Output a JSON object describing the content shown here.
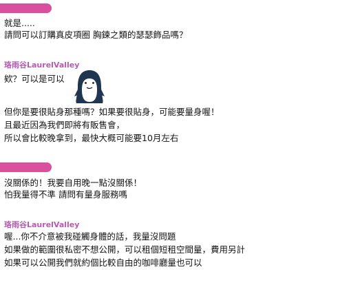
{
  "messages": [
    {
      "sender": "",
      "lines": [
        "就是.....",
        "請問可以訂購真皮項圈 胸鍊之類的瑟瑟飾品嗎？"
      ]
    },
    {
      "sender": "珞雨谷LaurelValley",
      "lines": [
        "欸？可以是可以"
      ]
    },
    {
      "sender": "",
      "lines": [
        "但你是要很貼身那種嗎？如果要很貼身，可能要量身喔！",
        "且最近因為我們即將有販售會，",
        "所以會比較晚拿到，最快大概可能要10月左右"
      ]
    },
    {
      "sender": "",
      "lines": [
        "沒關係的！我要自用晚一點沒關係！",
        "怕我量得不準 請問有量身服務嗎"
      ]
    },
    {
      "sender": "珞雨谷LaurelValley",
      "lines": [
        "喔...你不介意被我碰觸身體的話，我量沒問題",
        "如果做的範圍很私密不想公開，可以租個短租空間量，費用另計",
        "如果可以公開我們就約個比較自由的咖啡廳量也可以"
      ]
    }
  ],
  "colors": {
    "pill": "#d9519e",
    "sender": "#b45ab0"
  },
  "icons": {
    "sticker": "penguin-sticker-icon"
  }
}
